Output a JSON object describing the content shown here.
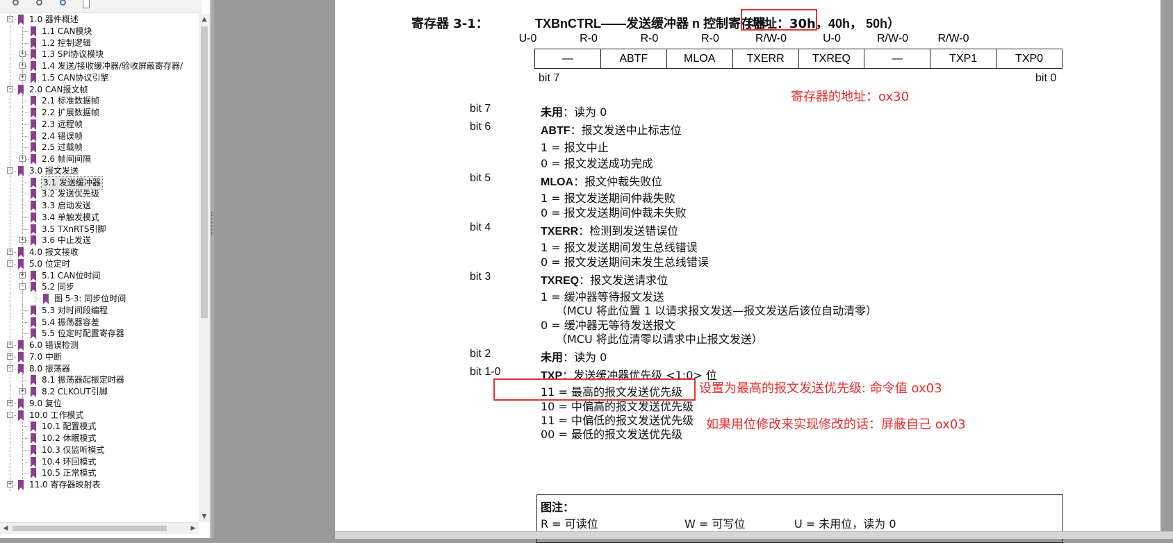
{
  "sidebar": {
    "tree": [
      {
        "label": "1.0 器件概述",
        "level": 0,
        "toggle": "-"
      },
      {
        "label": "1.1 CAN模块",
        "level": 1,
        "toggle": ""
      },
      {
        "label": "1.2 控制逻辑",
        "level": 1,
        "toggle": ""
      },
      {
        "label": "1.3 SPI协议模块",
        "level": 1,
        "toggle": "+"
      },
      {
        "label": "1.4 发送/接收缓冲器/验收屏蔽寄存器/",
        "level": 1,
        "toggle": "+"
      },
      {
        "label": "1.5 CAN协议引擎",
        "level": 1,
        "toggle": "+"
      },
      {
        "label": "2.0 CAN报文帧",
        "level": 0,
        "toggle": "-"
      },
      {
        "label": "2.1 标准数据帧",
        "level": 1,
        "toggle": ""
      },
      {
        "label": "2.2 扩展数据帧",
        "level": 1,
        "toggle": ""
      },
      {
        "label": "2.3 远程帧",
        "level": 1,
        "toggle": ""
      },
      {
        "label": "2.4 错误帧",
        "level": 1,
        "toggle": ""
      },
      {
        "label": "2.5 过载帧",
        "level": 1,
        "toggle": ""
      },
      {
        "label": "2.6 帧间间隔",
        "level": 1,
        "toggle": "+"
      },
      {
        "label": "3.0 报文发送",
        "level": 0,
        "toggle": "-"
      },
      {
        "label": "3.1 发送缓冲器",
        "level": 1,
        "toggle": "",
        "selected": true
      },
      {
        "label": "3.2 发送优先级",
        "level": 1,
        "toggle": ""
      },
      {
        "label": "3.3 启动发送",
        "level": 1,
        "toggle": ""
      },
      {
        "label": "3.4 单触发模式",
        "level": 1,
        "toggle": ""
      },
      {
        "label": "3.5 TXnRTS引脚",
        "level": 1,
        "toggle": ""
      },
      {
        "label": "3.6 中止发送",
        "level": 1,
        "toggle": "+"
      },
      {
        "label": "4.0 报文接收",
        "level": 0,
        "toggle": "+"
      },
      {
        "label": "5.0 位定时",
        "level": 0,
        "toggle": "-"
      },
      {
        "label": "5.1 CAN位时间",
        "level": 1,
        "toggle": "+"
      },
      {
        "label": "5.2 同步",
        "level": 1,
        "toggle": "-"
      },
      {
        "label": "图 5-3:  同步位时间",
        "level": 2,
        "toggle": ""
      },
      {
        "label": "5.3 对时间段编程",
        "level": 1,
        "toggle": ""
      },
      {
        "label": "5.4 振荡器容差",
        "level": 1,
        "toggle": ""
      },
      {
        "label": "5.5 位定时配置寄存器",
        "level": 1,
        "toggle": ""
      },
      {
        "label": "6.0 错误检测",
        "level": 0,
        "toggle": "+"
      },
      {
        "label": "7.0 中断",
        "level": 0,
        "toggle": "+"
      },
      {
        "label": "8.0 振荡器",
        "level": 0,
        "toggle": "-"
      },
      {
        "label": "8.1 振荡器起振定时器",
        "level": 1,
        "toggle": ""
      },
      {
        "label": "8.2 CLKOUT引脚",
        "level": 1,
        "toggle": "+"
      },
      {
        "label": "9.0 复位",
        "level": 0,
        "toggle": "+"
      },
      {
        "label": "10.0 工作模式",
        "level": 0,
        "toggle": "-"
      },
      {
        "label": "10.1 配置模式",
        "level": 1,
        "toggle": ""
      },
      {
        "label": "10.2 休眠模式",
        "level": 1,
        "toggle": ""
      },
      {
        "label": "10.3 仅监听模式",
        "level": 1,
        "toggle": ""
      },
      {
        "label": "10.4 环回模式",
        "level": 1,
        "toggle": ""
      },
      {
        "label": "10.5 正常模式",
        "level": 1,
        "toggle": ""
      },
      {
        "label": "11.0 寄存器映射表",
        "level": 0,
        "toggle": "+"
      }
    ]
  },
  "doc": {
    "reg_heading": "寄存器 3-1：",
    "reg_title": "TXBnCTRL——发送缓冲器 n 控制寄存器",
    "reg_addr_boxed": "（地址：30h，",
    "reg_addr_rest": "40h，  50h）",
    "access": [
      "U-0",
      "R-0",
      "R-0",
      "R-0",
      "R/W-0",
      "U-0",
      "R/W-0",
      "R/W-0"
    ],
    "bits": [
      "—",
      "ABTF",
      "MLOA",
      "TXERR",
      "TXREQ",
      "—",
      "TXP1",
      "TXP0"
    ],
    "bit7_label": "bit 7",
    "bit0_label": "bit 0",
    "annotation_addr": "寄存器的地址：ox30",
    "annotation_priority": "设置为最高的报文发送优先级: 命令值 ox03",
    "annotation_mask": "如果用位修改来实现修改的话：屏蔽自己 ox03",
    "b7": {
      "label": "bit 7",
      "name": "未用",
      "desc": "：读为 0"
    },
    "b6": {
      "label": "bit 6",
      "name": "ABTF",
      "desc": "：报文发送中止标志位",
      "v1": "1 =  报文中止",
      "v0": "0 =  报文发送成功完成"
    },
    "b5": {
      "label": "bit 5",
      "name": "MLOA",
      "desc": "：报文仲裁失败位",
      "v1": "1 =  报文发送期间仲裁失败",
      "v0": "0 =  报文发送期间仲裁未失败"
    },
    "b4": {
      "label": "bit 4",
      "name": "TXERR",
      "desc": "：检测到发送错误位",
      "v1": "1 =  报文发送期间发生总线错误",
      "v0": "0 =  报文发送期间未发生总线错误"
    },
    "b3": {
      "label": "bit 3",
      "name": "TXREQ",
      "desc": "：报文发送请求位",
      "v1": "1 = 缓冲器等待报文发送",
      "n1": "（MCU 将此位置 1 以请求报文发送—报文发送后该位自动清零）",
      "v0": "0 = 缓冲器无等待发送报文",
      "n0": "（MCU 将此位清零以请求中止报文发送）"
    },
    "b2": {
      "label": "bit 2",
      "name": "未用",
      "desc": "：读为 0"
    },
    "b10": {
      "label": "bit 1-0",
      "name": "TXP",
      "desc": "：发送缓冲器优先级 <1:0> 位",
      "p11": "11 =    最高的报文发送优先级",
      "p10": "10 =    中偏高的报文发送优先级",
      "p01": "11 =    中偏低的报文发送优先级",
      "p00": "00 =    最低的报文发送优先级"
    },
    "legend": {
      "title": "图注：",
      "r": "R = 可读位",
      "w": "W = 可写位",
      "u": "U = 未用位，读为 0"
    }
  }
}
